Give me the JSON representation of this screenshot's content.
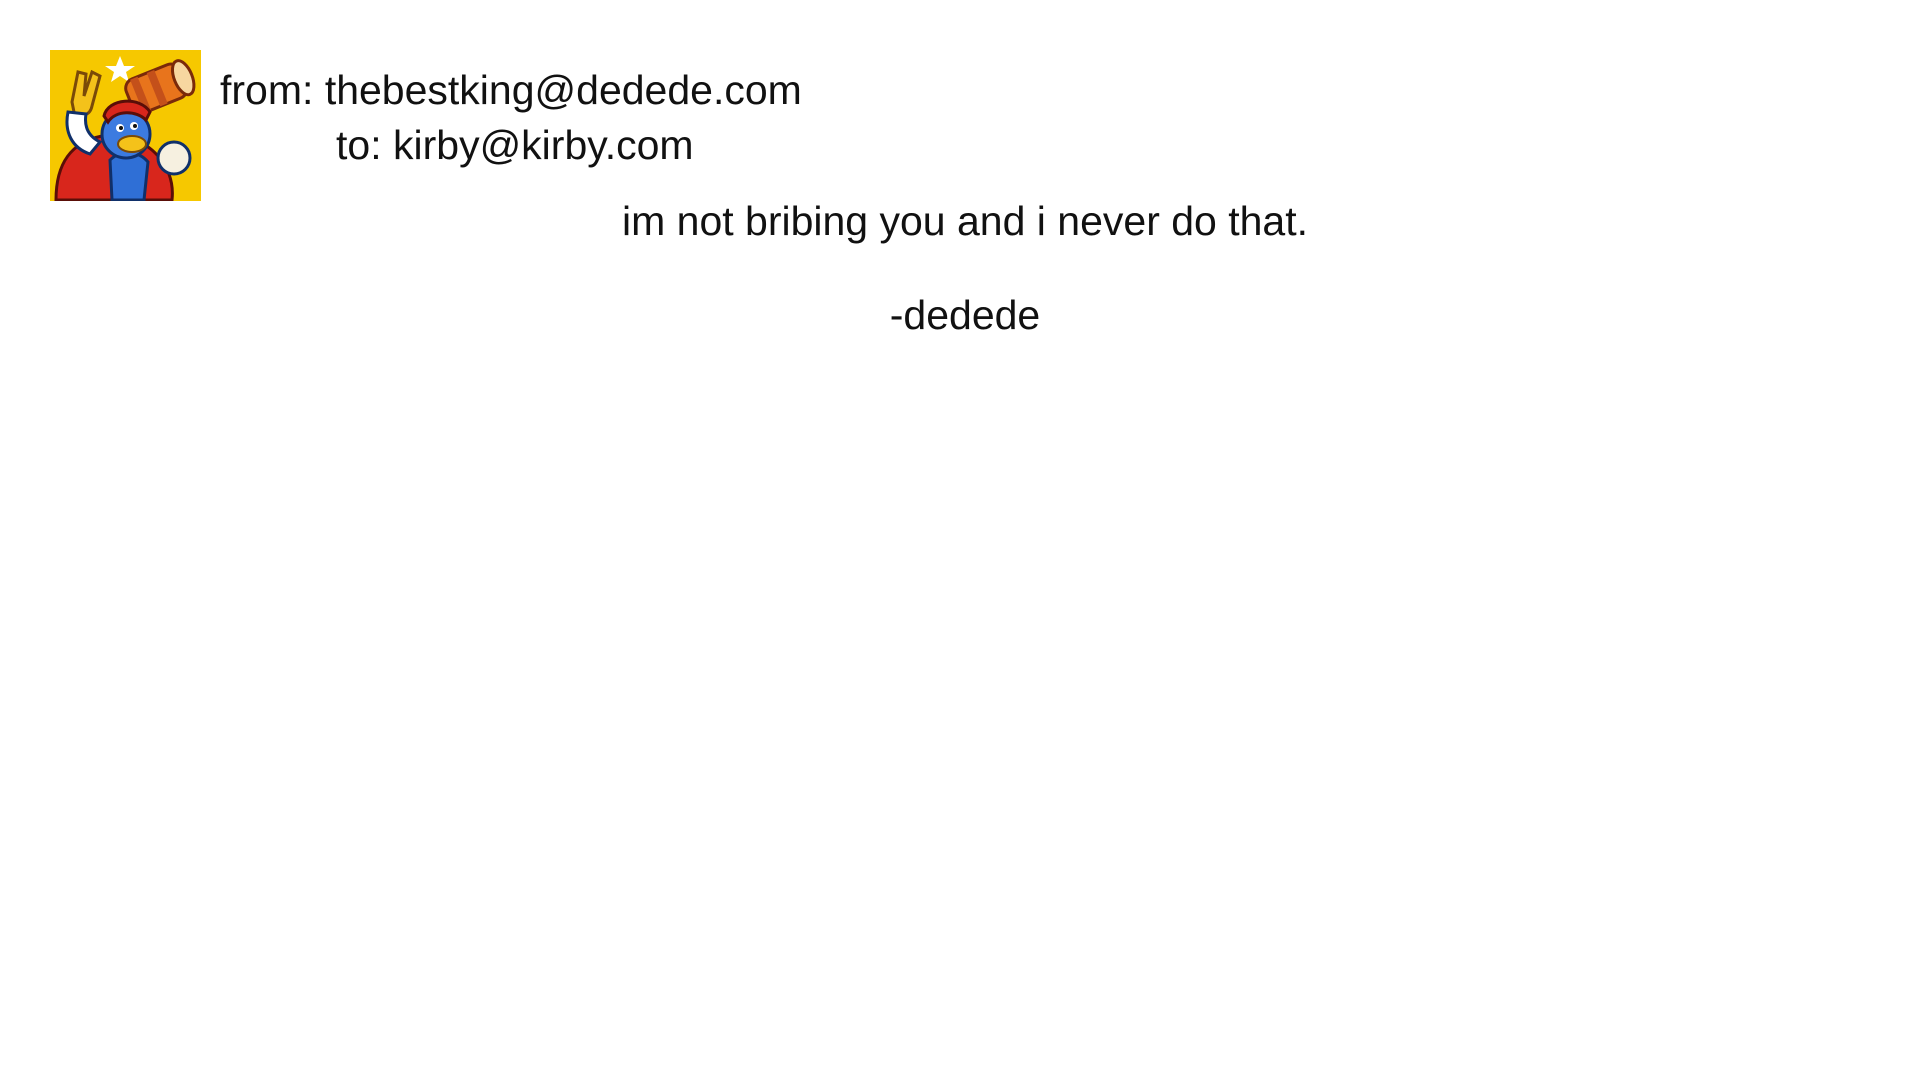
{
  "email": {
    "sender_avatar": {
      "icon": "king-dedede-avatar",
      "background_color": "#f6c800"
    },
    "from_label": "from:",
    "from_address": "thebestking@dedede.com",
    "to_label": "to:",
    "to_address": "kirby@kirby.com",
    "message": "im not bribing you and i never do that.",
    "signature": "-dedede"
  }
}
